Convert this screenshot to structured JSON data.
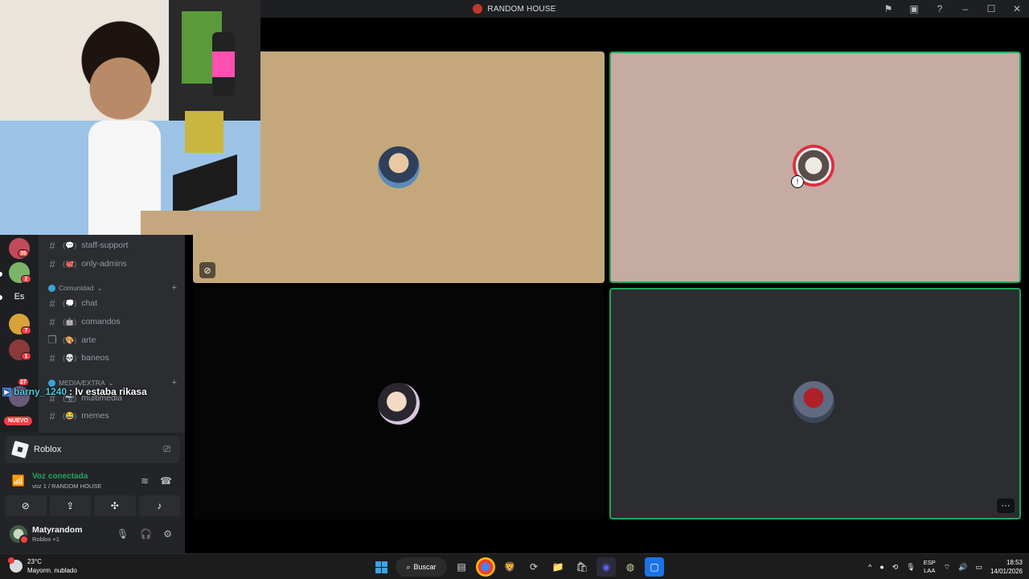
{
  "window": {
    "title": "RANDOM HOUSE",
    "icons": [
      "flag-icon",
      "inbox-icon",
      "help-icon",
      "minimize-icon",
      "maximize-icon",
      "close-icon"
    ]
  },
  "call": {
    "tiles": [
      {
        "name": "participant-1",
        "bg": "#c4a87c",
        "muted": true
      },
      {
        "name": "participant-2",
        "bg": "#c5aba1",
        "speaking": true
      },
      {
        "name": "participant-3",
        "bg": "#050505"
      },
      {
        "name": "participant-4",
        "bg": "#2b2d31",
        "speaking": true
      }
    ],
    "more_label": "···"
  },
  "rail": {
    "badges": [
      "39",
      "2",
      "7",
      "1",
      "27"
    ],
    "es_label": "Es",
    "nuevo_label": "NUEVO"
  },
  "channels": {
    "items_top": [
      {
        "name": "staff-support",
        "emoji": "(💬)"
      },
      {
        "name": "only-admins",
        "emoji": "(🐙)"
      }
    ],
    "cat_comunidad": "Comunidad",
    "items_comunidad": [
      {
        "name": "chat",
        "emoji": "(💭)"
      },
      {
        "name": "comandos",
        "emoji": "(🤖)"
      },
      {
        "name": "arte",
        "emoji": "(🎨)"
      },
      {
        "name": "baneos",
        "emoji": "(💀)"
      }
    ],
    "cat_media": "MEDIA/EXTRA",
    "items_media": [
      {
        "name": "multimedia",
        "emoji": "(📷)"
      },
      {
        "name": "memes",
        "emoji": "(😂)"
      }
    ]
  },
  "chat_overlay": {
    "user": "barny_1240",
    "message": ": lv estaba rikasa"
  },
  "panel": {
    "activity": "Roblox",
    "voice_status": "Voz conectada",
    "voice_channel": "voz 1 / RANDOM HOUSE",
    "username": "Matyrandom",
    "user_status": "Roblox +1"
  },
  "taskbar": {
    "weather_temp": "23°C",
    "weather_desc": "Mayorm. nublado",
    "search_label": "Buscar",
    "lang_1": "ESP",
    "lang_2": "LAA",
    "time": "18:53",
    "date": "14/01/2026"
  },
  "colors": {
    "accent_green": "#23a55a",
    "badge_red": "#f23f43"
  }
}
